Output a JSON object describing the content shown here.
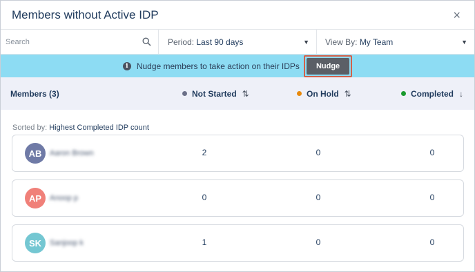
{
  "dialog": {
    "title": "Members without Active IDP",
    "close_label": "×"
  },
  "filters": {
    "search_placeholder": "Search",
    "period_label": "Period: ",
    "period_value": "Last 90 days",
    "viewby_label": "View By: ",
    "viewby_value": "My Team"
  },
  "banner": {
    "message": "Nudge members to take action on their IDPs",
    "nudge_label": "Nudge"
  },
  "columns": {
    "members": "Members (3)",
    "not_started": "Not Started",
    "on_hold": "On Hold",
    "completed": "Completed",
    "colors": {
      "not_started": "#6b7088",
      "on_hold": "#e8890c",
      "completed": "#1a9a2e"
    }
  },
  "sorted": {
    "label": "Sorted by: ",
    "value": "Highest Completed IDP count"
  },
  "members": [
    {
      "initials": "AB",
      "name": "Aaron Brown",
      "avatar_color": "#6f7aa6",
      "not_started": "2",
      "on_hold": "0",
      "completed": "0"
    },
    {
      "initials": "AP",
      "name": "Anoop p",
      "avatar_color": "#f08079",
      "not_started": "0",
      "on_hold": "0",
      "completed": "0"
    },
    {
      "initials": "SK",
      "name": "Sanjoop k",
      "avatar_color": "#74c7d2",
      "not_started": "1",
      "on_hold": "0",
      "completed": "0"
    }
  ]
}
